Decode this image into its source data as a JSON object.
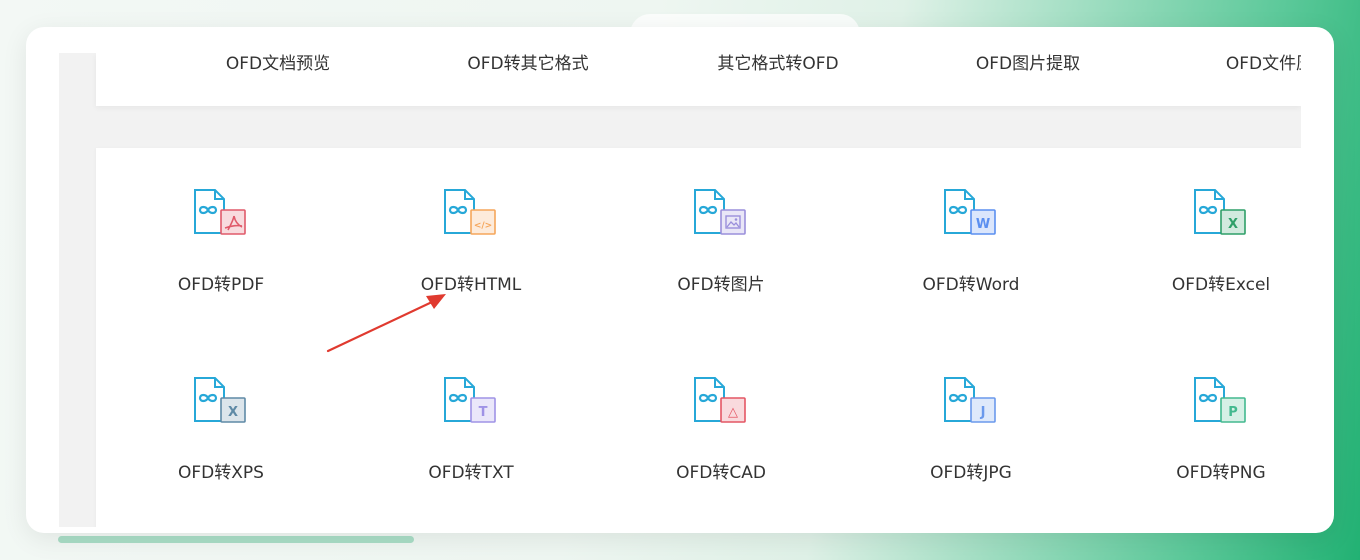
{
  "top_tabs": [
    {
      "label": "OFD文档预览"
    },
    {
      "label": "OFD转其它格式"
    },
    {
      "label": "其它格式转OFD"
    },
    {
      "label": "OFD图片提取"
    },
    {
      "label": "OFD文件压缩"
    }
  ],
  "tools": [
    {
      "label": "OFD转PDF",
      "badge": "pdf-icon",
      "color": "#e05a6a",
      "glyph": ""
    },
    {
      "label": "OFD转HTML",
      "badge": "html-code-icon",
      "color": "#f5a65b",
      "glyph": "</>"
    },
    {
      "label": "OFD转图片",
      "badge": "image-icon",
      "color": "#9a8fdb",
      "glyph": ""
    },
    {
      "label": "OFD转Word",
      "badge": "word-icon",
      "color": "#5b8ff0",
      "glyph": "W"
    },
    {
      "label": "OFD转Excel",
      "badge": "excel-icon",
      "color": "#2f9f68",
      "glyph": "X"
    },
    {
      "label": "OFD转XPS",
      "badge": "xps-icon",
      "color": "#5f8aa6",
      "glyph": "X"
    },
    {
      "label": "OFD转TXT",
      "badge": "txt-icon",
      "color": "#9f93e6",
      "glyph": "T"
    },
    {
      "label": "OFD转CAD",
      "badge": "cad-icon",
      "color": "#e45664",
      "glyph": "△"
    },
    {
      "label": "OFD转JPG",
      "badge": "jpg-icon",
      "color": "#6a99ec",
      "glyph": "J"
    },
    {
      "label": "OFD转PNG",
      "badge": "png-icon",
      "color": "#43b98f",
      "glyph": "P"
    }
  ],
  "colors": {
    "file_icon": "#27a8d8",
    "annotation_arrow": "#e03a2f",
    "accent_green": "#22b173"
  },
  "annotation": {
    "icon": "red-arrow-icon",
    "points_to": "OFD转HTML"
  }
}
